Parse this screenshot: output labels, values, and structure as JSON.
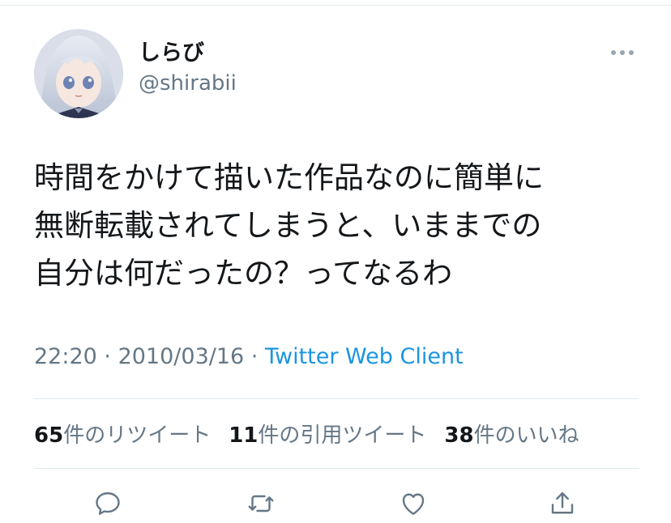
{
  "user": {
    "display_name": "しらび",
    "handle": "@shirabii"
  },
  "tweet": {
    "lines": [
      "時間をかけて描いた作品なのに簡単に",
      "無断転載されてしまうと、いままでの",
      "自分は何だったの？ってなるわ"
    ],
    "time": "22:20",
    "separator": "·",
    "date": "2010/03/16",
    "client": "Twitter Web Client"
  },
  "stats": {
    "retweets_count": "65",
    "retweets_label": "件のリツイート",
    "quotes_count": "11",
    "quotes_label": "件の引用ツイート",
    "likes_count": "38",
    "likes_label": "件のいいね"
  },
  "colors": {
    "text": "#14171a",
    "muted": "#657786",
    "link": "#1b95e0",
    "divider": "#e1e8ed",
    "icon": "#657786"
  },
  "icons": [
    "more-icon",
    "reply-icon",
    "retweet-icon",
    "like-icon",
    "share-icon"
  ]
}
